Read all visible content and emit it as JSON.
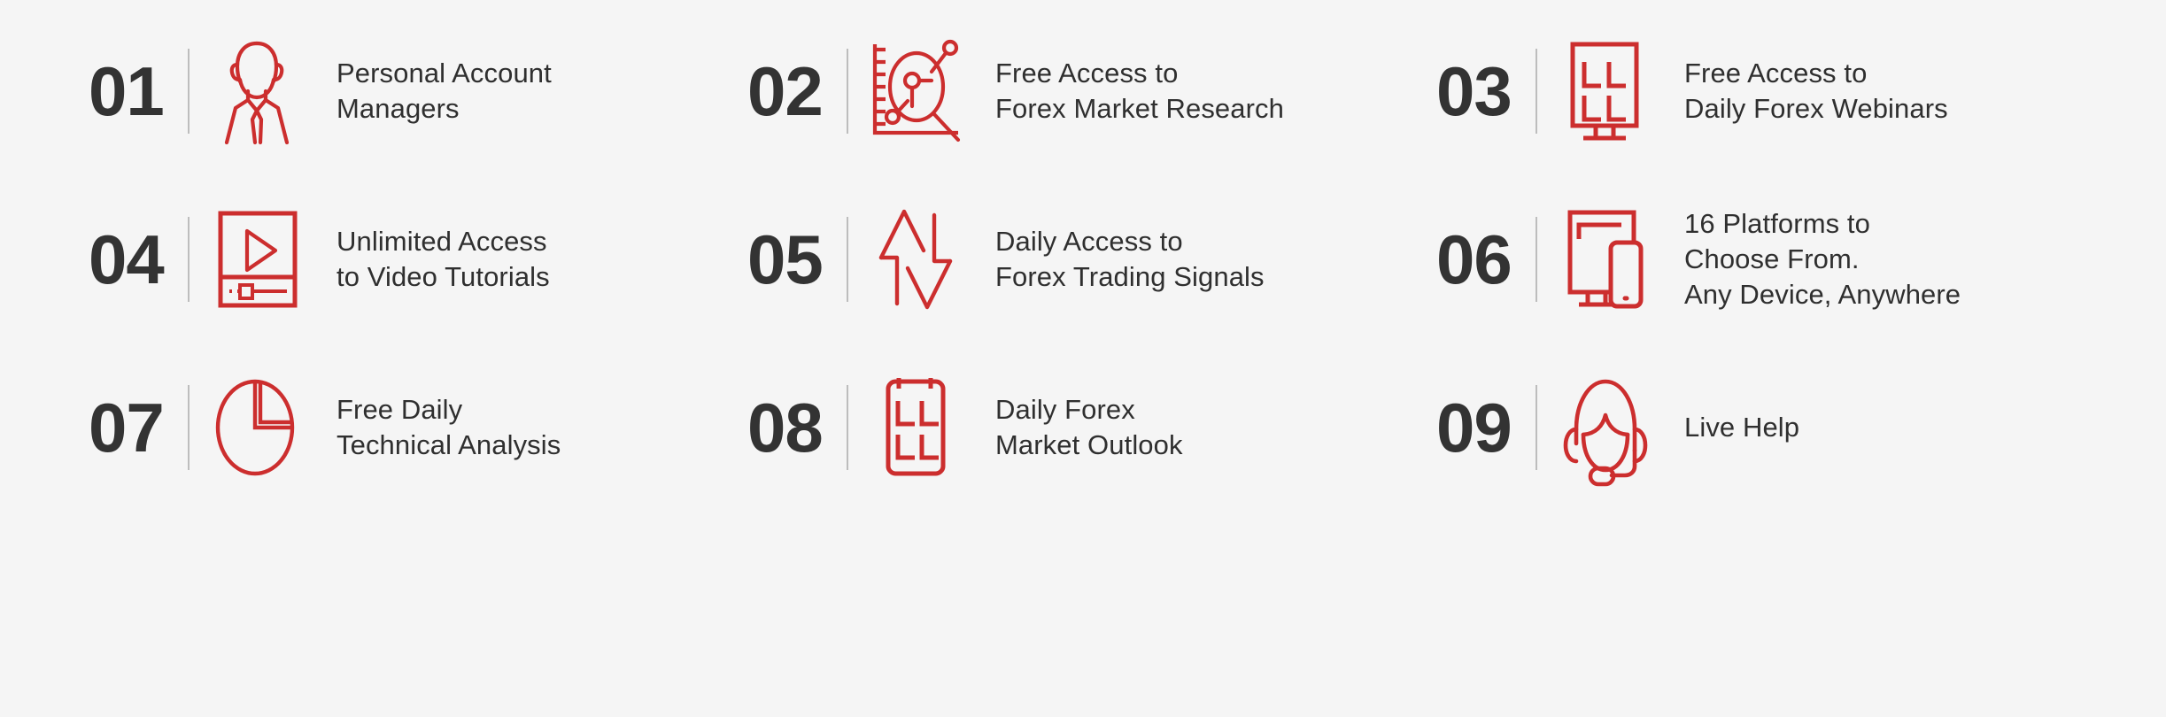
{
  "theme": {
    "background": "#f5f5f5",
    "accent_red": "#cc2e2e",
    "number_color": "#333333",
    "label_color": "#2f2f2f",
    "divider_color": "#bdbdbd"
  },
  "items": [
    {
      "number": "01",
      "icon": "person-account-manager-icon",
      "label": "Personal Account\nManagers"
    },
    {
      "number": "02",
      "icon": "chart-magnifier-research-icon",
      "label": "Free Access to\nForex Market Research"
    },
    {
      "number": "03",
      "icon": "webinar-monitor-icon",
      "label": "Free Access to\nDaily Forex Webinars"
    },
    {
      "number": "04",
      "icon": "video-player-icon",
      "label": "Unlimited Access\nto Video Tutorials"
    },
    {
      "number": "05",
      "icon": "up-down-arrows-signals-icon",
      "label": "Daily Access to\nForex Trading Signals"
    },
    {
      "number": "06",
      "icon": "desktop-mobile-devices-icon",
      "label": "16 Platforms to\nChoose From.\nAny Device, Anywhere"
    },
    {
      "number": "07",
      "icon": "pie-chart-analysis-icon",
      "label": "Free Daily\nTechnical Analysis"
    },
    {
      "number": "08",
      "icon": "market-outlook-grid-icon",
      "label": "Daily Forex\nMarket Outlook"
    },
    {
      "number": "09",
      "icon": "headset-support-agent-icon",
      "label": "Live Help"
    }
  ]
}
